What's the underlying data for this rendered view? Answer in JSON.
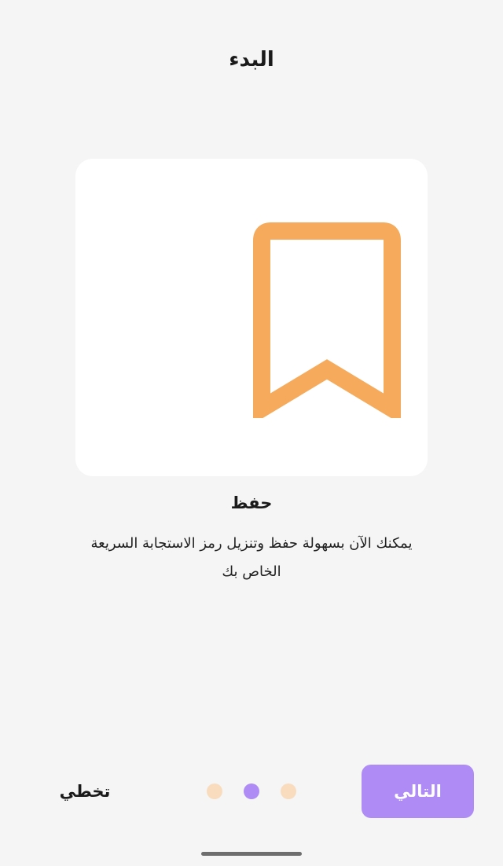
{
  "header": {
    "title": "البدء"
  },
  "card": {
    "icon": "bookmark-icon",
    "icon_color": "#f5ab5b",
    "background": "#ffffff"
  },
  "feature": {
    "title": "حفظ",
    "description_line1": "يمكنك الآن بسهولة حفظ وتنزيل رمز الاستجابة السريعة",
    "description_line2": "الخاص بك"
  },
  "footer": {
    "next_label": "التالي",
    "skip_label": "تخطي",
    "page_count": 3,
    "active_page": 2,
    "accent_color": "#ae8bf5",
    "inactive_dot_color": "#f8dcbd"
  }
}
